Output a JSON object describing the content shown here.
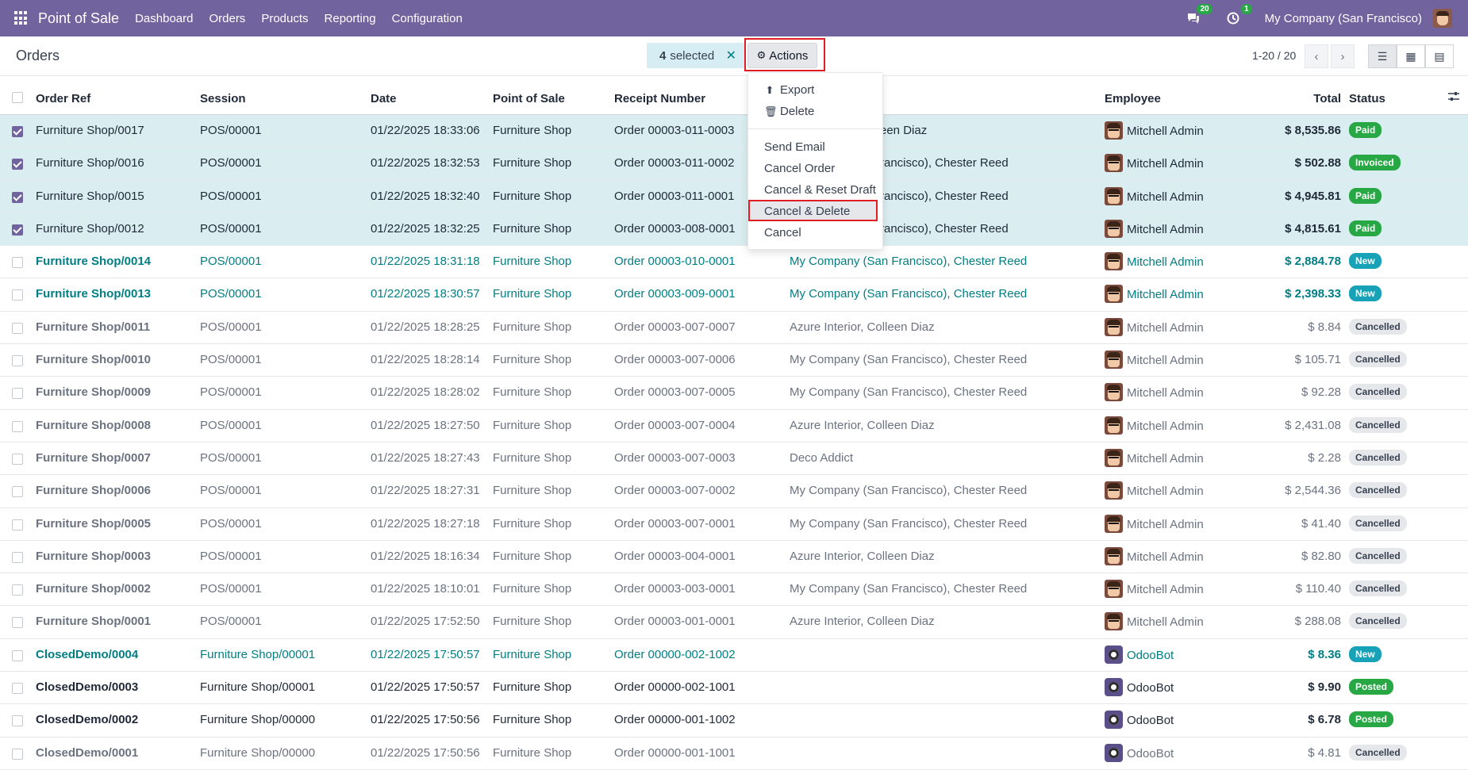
{
  "topbar": {
    "app_name": "Point of Sale",
    "menu": [
      "Dashboard",
      "Orders",
      "Products",
      "Reporting",
      "Configuration"
    ],
    "messages_count": "20",
    "activities_count": "1",
    "company": "My Company (San Francisco)"
  },
  "control": {
    "title": "Orders",
    "selected_count": "4",
    "selected_label": "selected",
    "actions_label": "Actions",
    "pager": "1-20 / 20"
  },
  "actions_menu": {
    "export": "Export",
    "delete": "Delete",
    "items": [
      "Send Email",
      "Cancel Order",
      "Cancel & Reset Draft",
      "Cancel & Delete",
      "Cancel"
    ]
  },
  "columns": [
    "Order Ref",
    "Session",
    "Date",
    "Point of Sale",
    "Receipt Number",
    "Employee",
    "Total",
    "Status"
  ],
  "rows": [
    {
      "ref": "Furniture Shop/0017",
      "session": "POS/00001",
      "date": "01/22/2025 18:33:06",
      "pos": "Furniture Shop",
      "receipt": "Order 00003-011-0003",
      "customer": "een Diaz",
      "employee": "Mitchell Admin",
      "total": "$ 8,535.86",
      "status": "Paid"
    },
    {
      "ref": "Furniture Shop/0016",
      "session": "POS/00001",
      "date": "01/22/2025 18:32:53",
      "pos": "Furniture Shop",
      "receipt": "Order 00003-011-0002",
      "customer": "rancisco), Chester Reed",
      "employee": "Mitchell Admin",
      "total": "$ 502.88",
      "status": "Invoiced"
    },
    {
      "ref": "Furniture Shop/0015",
      "session": "POS/00001",
      "date": "01/22/2025 18:32:40",
      "pos": "Furniture Shop",
      "receipt": "Order 00003-011-0001",
      "customer": "rancisco), Chester Reed",
      "employee": "Mitchell Admin",
      "total": "$ 4,945.81",
      "status": "Paid"
    },
    {
      "ref": "Furniture Shop/0012",
      "session": "POS/00001",
      "date": "01/22/2025 18:32:25",
      "pos": "Furniture Shop",
      "receipt": "Order 00003-008-0001",
      "customer": "rancisco), Chester Reed",
      "employee": "Mitchell Admin",
      "total": "$ 4,815.61",
      "status": "Paid"
    },
    {
      "ref": "Furniture Shop/0014",
      "session": "POS/00001",
      "date": "01/22/2025 18:31:18",
      "pos": "Furniture Shop",
      "receipt": "Order 00003-010-0001",
      "customer": "My Company (San Francisco), Chester Reed",
      "employee": "Mitchell Admin",
      "total": "$ 2,884.78",
      "status": "New"
    },
    {
      "ref": "Furniture Shop/0013",
      "session": "POS/00001",
      "date": "01/22/2025 18:30:57",
      "pos": "Furniture Shop",
      "receipt": "Order 00003-009-0001",
      "customer": "My Company (San Francisco), Chester Reed",
      "employee": "Mitchell Admin",
      "total": "$ 2,398.33",
      "status": "New"
    },
    {
      "ref": "Furniture Shop/0011",
      "session": "POS/00001",
      "date": "01/22/2025 18:28:25",
      "pos": "Furniture Shop",
      "receipt": "Order 00003-007-0007",
      "customer": "Azure Interior, Colleen Diaz",
      "employee": "Mitchell Admin",
      "total": "$ 8.84",
      "status": "Cancelled"
    },
    {
      "ref": "Furniture Shop/0010",
      "session": "POS/00001",
      "date": "01/22/2025 18:28:14",
      "pos": "Furniture Shop",
      "receipt": "Order 00003-007-0006",
      "customer": "My Company (San Francisco), Chester Reed",
      "employee": "Mitchell Admin",
      "total": "$ 105.71",
      "status": "Cancelled"
    },
    {
      "ref": "Furniture Shop/0009",
      "session": "POS/00001",
      "date": "01/22/2025 18:28:02",
      "pos": "Furniture Shop",
      "receipt": "Order 00003-007-0005",
      "customer": "My Company (San Francisco), Chester Reed",
      "employee": "Mitchell Admin",
      "total": "$ 92.28",
      "status": "Cancelled"
    },
    {
      "ref": "Furniture Shop/0008",
      "session": "POS/00001",
      "date": "01/22/2025 18:27:50",
      "pos": "Furniture Shop",
      "receipt": "Order 00003-007-0004",
      "customer": "Azure Interior, Colleen Diaz",
      "employee": "Mitchell Admin",
      "total": "$ 2,431.08",
      "status": "Cancelled"
    },
    {
      "ref": "Furniture Shop/0007",
      "session": "POS/00001",
      "date": "01/22/2025 18:27:43",
      "pos": "Furniture Shop",
      "receipt": "Order 00003-007-0003",
      "customer": "Deco Addict",
      "employee": "Mitchell Admin",
      "total": "$ 2.28",
      "status": "Cancelled"
    },
    {
      "ref": "Furniture Shop/0006",
      "session": "POS/00001",
      "date": "01/22/2025 18:27:31",
      "pos": "Furniture Shop",
      "receipt": "Order 00003-007-0002",
      "customer": "My Company (San Francisco), Chester Reed",
      "employee": "Mitchell Admin",
      "total": "$ 2,544.36",
      "status": "Cancelled"
    },
    {
      "ref": "Furniture Shop/0005",
      "session": "POS/00001",
      "date": "01/22/2025 18:27:18",
      "pos": "Furniture Shop",
      "receipt": "Order 00003-007-0001",
      "customer": "My Company (San Francisco), Chester Reed",
      "employee": "Mitchell Admin",
      "total": "$ 41.40",
      "status": "Cancelled"
    },
    {
      "ref": "Furniture Shop/0003",
      "session": "POS/00001",
      "date": "01/22/2025 18:16:34",
      "pos": "Furniture Shop",
      "receipt": "Order 00003-004-0001",
      "customer": "Azure Interior, Colleen Diaz",
      "employee": "Mitchell Admin",
      "total": "$ 82.80",
      "status": "Cancelled"
    },
    {
      "ref": "Furniture Shop/0002",
      "session": "POS/00001",
      "date": "01/22/2025 18:10:01",
      "pos": "Furniture Shop",
      "receipt": "Order 00003-003-0001",
      "customer": "My Company (San Francisco), Chester Reed",
      "employee": "Mitchell Admin",
      "total": "$ 110.40",
      "status": "Cancelled"
    },
    {
      "ref": "Furniture Shop/0001",
      "session": "POS/00001",
      "date": "01/22/2025 17:52:50",
      "pos": "Furniture Shop",
      "receipt": "Order 00003-001-0001",
      "customer": "Azure Interior, Colleen Diaz",
      "employee": "Mitchell Admin",
      "total": "$ 288.08",
      "status": "Cancelled"
    },
    {
      "ref": "ClosedDemo/0004",
      "session": "Furniture Shop/00001",
      "date": "01/22/2025 17:50:57",
      "pos": "Furniture Shop",
      "receipt": "Order 00000-002-1002",
      "customer": "",
      "employee": "OdooBot",
      "total": "$ 8.36",
      "status": "New"
    },
    {
      "ref": "ClosedDemo/0003",
      "session": "Furniture Shop/00001",
      "date": "01/22/2025 17:50:57",
      "pos": "Furniture Shop",
      "receipt": "Order 00000-002-1001",
      "customer": "",
      "employee": "OdooBot",
      "total": "$ 9.90",
      "status": "Posted"
    },
    {
      "ref": "ClosedDemo/0002",
      "session": "Furniture Shop/00000",
      "date": "01/22/2025 17:50:56",
      "pos": "Furniture Shop",
      "receipt": "Order 00000-001-1002",
      "customer": "",
      "employee": "OdooBot",
      "total": "$ 6.78",
      "status": "Posted"
    },
    {
      "ref": "ClosedDemo/0001",
      "session": "Furniture Shop/00000",
      "date": "01/22/2025 17:50:56",
      "pos": "Furniture Shop",
      "receipt": "Order 00000-001-1001",
      "customer": "",
      "employee": "OdooBot",
      "total": "$ 4.81",
      "status": "Cancelled"
    }
  ],
  "row_styles": [
    "sel",
    "sel",
    "sel",
    "sel",
    "link",
    "link",
    "grey",
    "grey",
    "grey",
    "grey",
    "grey",
    "grey",
    "grey",
    "grey",
    "grey",
    "grey",
    "link",
    "bold",
    "bold",
    "grey"
  ],
  "colors": {
    "brand": "#71639e",
    "accent": "#017e84",
    "highlight": "#e11d24"
  }
}
